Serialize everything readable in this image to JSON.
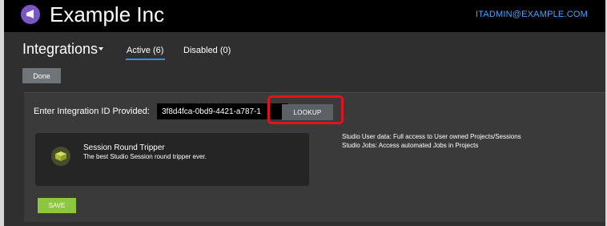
{
  "header": {
    "app_title": "Example Inc",
    "user_email": "ITADMIN@EXAMPLE.COM"
  },
  "section": {
    "title": "Integrations",
    "tabs": [
      {
        "label": "Active (6)",
        "active": true
      },
      {
        "label": "Disabled (0)",
        "active": false
      }
    ],
    "done_label": "Done"
  },
  "form": {
    "id_label": "Enter Integration ID Provided:",
    "id_value": "3f8d4fca-0bd9-4421-a787-1",
    "lookup_label": "LOOKUP",
    "save_label": "SAVE"
  },
  "integration": {
    "name": "Session Round Tripper",
    "description": "The best Studio Session round tripper ever.",
    "scopes": [
      "Studio User data: Full access to User owned Projects/Sessions",
      "Studio Jobs: Access automated Jobs in Projects"
    ]
  },
  "colors": {
    "accent": "#3a8fe0",
    "save": "#8dc63f",
    "highlight": "#e0141a",
    "logo": "#7a56c2"
  },
  "icons": [
    "megaphone-icon",
    "cube-icon",
    "caret-down-icon"
  ]
}
